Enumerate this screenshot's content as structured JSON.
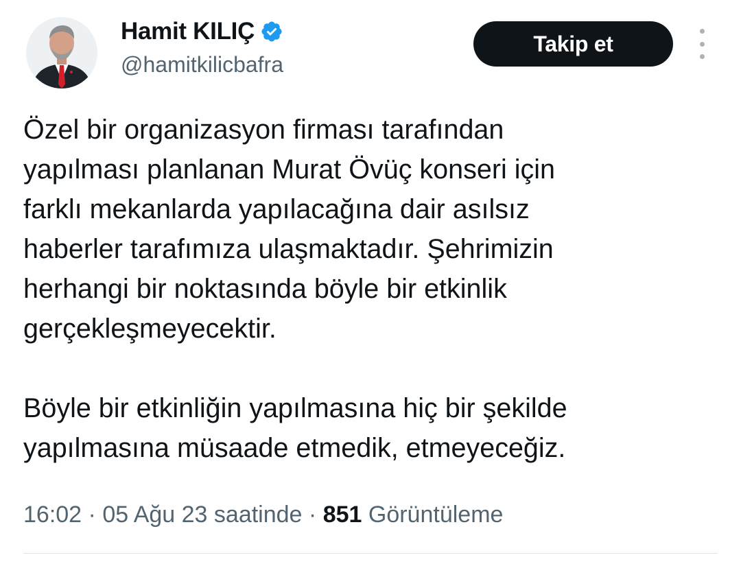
{
  "author": {
    "display_name": "Hamit KILIÇ",
    "handle": "@hamitkilicbafra",
    "verified_icon": "verified-badge-icon",
    "avatar_icon": "profile-photo"
  },
  "actions": {
    "follow_label": "Takip et",
    "more_icon": "more-options-icon"
  },
  "tweet": {
    "paragraphs": [
      "Özel bir organizasyon firması tarafından\nyapılması planlanan Murat Övüç konseri için\nfarklı mekanlarda yapılacağına dair asılsız\nhaberler tarafımıza ulaşmaktadır. Şehrimizin\nherhangi bir noktasında böyle bir etkinlik\ngerçekleşmeyecektir.",
      "Böyle bir etkinliğin yapılmasına hiç bir şekilde\nyapılmasına müsaade etmedik, etmeyeceğiz."
    ]
  },
  "meta": {
    "time": "16:02",
    "separator": " · ",
    "date": "05 Ağu 23 saatinde",
    "views_count": "851",
    "views_label": "Görüntüleme"
  },
  "colors": {
    "text": "#0f1419",
    "secondary": "#536471",
    "verified": "#1d9bf0",
    "button_bg": "#0f1419"
  }
}
